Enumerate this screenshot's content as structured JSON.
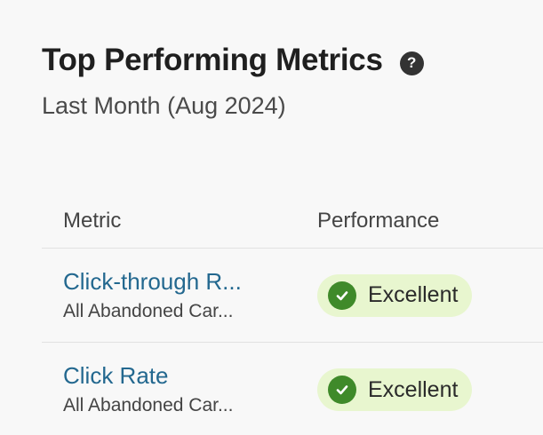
{
  "header": {
    "title": "Top Performing Metrics",
    "help_icon": "question-circle-icon",
    "subtitle": "Last Month (Aug 2024)"
  },
  "table": {
    "columns": [
      "Metric",
      "Performance"
    ],
    "rows": [
      {
        "metric": "Click-through R...",
        "sub": "All Abandoned Car...",
        "performance": "Excellent",
        "performance_icon": "check-circle-icon"
      },
      {
        "metric": "Click Rate",
        "sub": "All Abandoned Car...",
        "performance": "Excellent",
        "performance_icon": "check-circle-icon"
      }
    ]
  },
  "colors": {
    "link": "#23688f",
    "badge_bg": "#e8f6cf",
    "badge_icon": "#3f8a2a"
  }
}
